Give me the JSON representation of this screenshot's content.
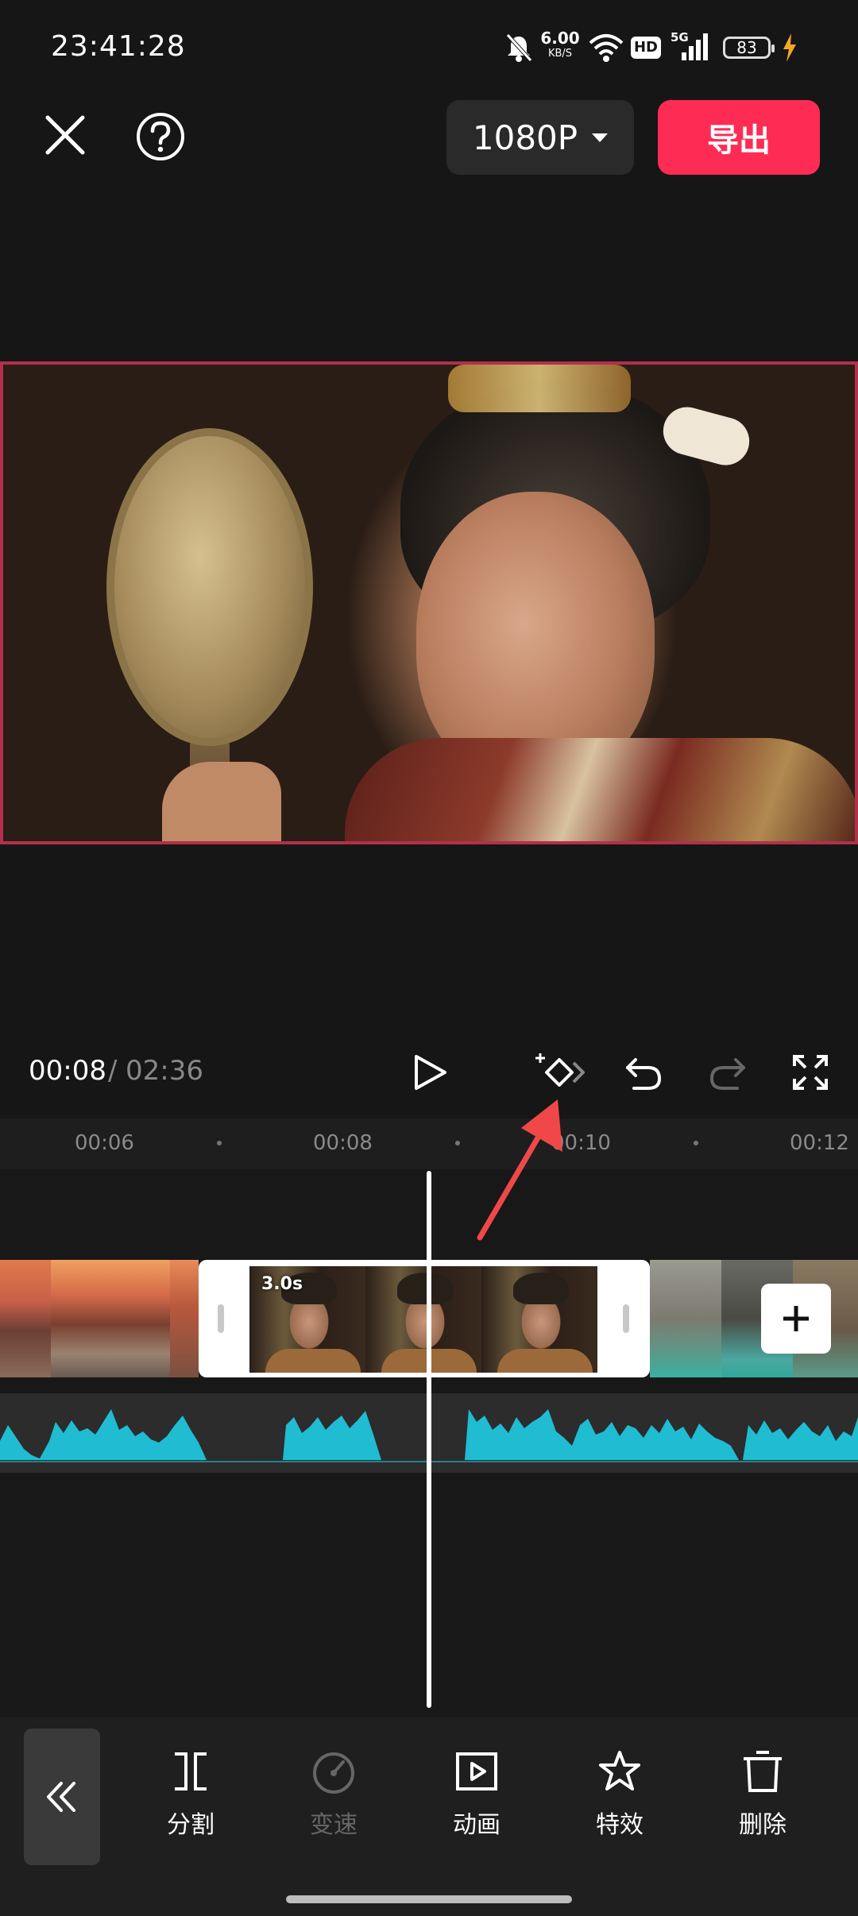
{
  "status_bar": {
    "time": "23:41:28",
    "net_speed_value": "6.00",
    "net_speed_unit": "KB/S",
    "hd_label": "HD",
    "network_label": "5G",
    "battery_level": "83",
    "icons": [
      "bell-muted-icon",
      "wifi-icon",
      "hd-icon",
      "signal-icon",
      "battery-icon",
      "charging-icon"
    ]
  },
  "top_bar": {
    "resolution_label": "1080P",
    "export_label": "导出"
  },
  "playback": {
    "current_time": "00:08",
    "separator": "/",
    "total_time": "02:36"
  },
  "ruler": {
    "labels": [
      "00:06",
      "00:08",
      "00:10",
      "00:12"
    ]
  },
  "timeline": {
    "selected_clip_duration": "3.0s"
  },
  "toolbar": {
    "items": [
      {
        "label": "分割",
        "icon": "split-icon",
        "enabled": true
      },
      {
        "label": "变速",
        "icon": "speed-icon",
        "enabled": false
      },
      {
        "label": "动画",
        "icon": "animation-icon",
        "enabled": true
      },
      {
        "label": "特效",
        "icon": "effects-icon",
        "enabled": true
      },
      {
        "label": "删除",
        "icon": "delete-icon",
        "enabled": true
      }
    ]
  },
  "colors": {
    "accent": "#fe2c55",
    "audio_wave": "#1fbcd2",
    "background": "#161616"
  }
}
